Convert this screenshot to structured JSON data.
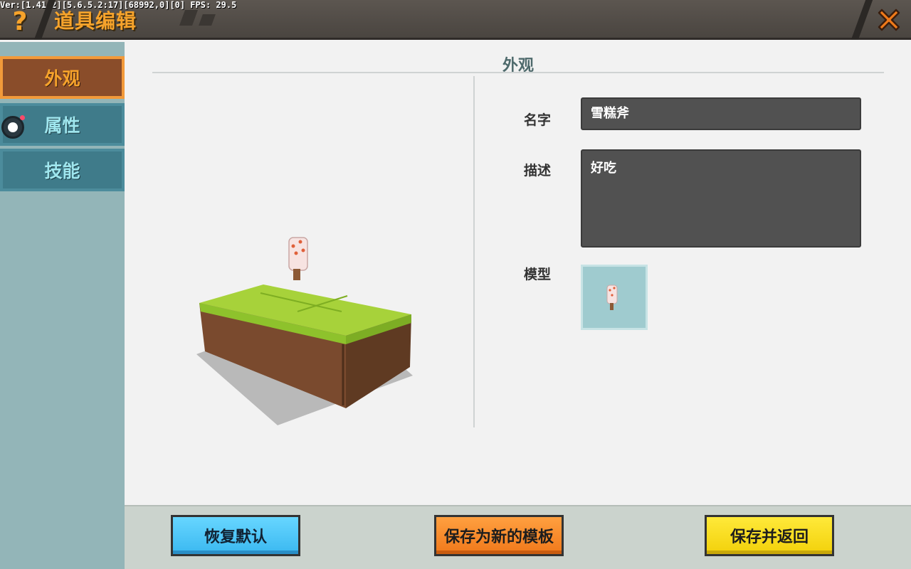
{
  "header": {
    "version": "Ver:[1.41.2][5.6.5.2:17][68992,0][0] FPS: 29.5",
    "help_glyph": "?",
    "title": "道具编辑",
    "help_icon": "question-mark-icon",
    "close_icon": "close-x-icon"
  },
  "sidebar": {
    "tabs": [
      {
        "label": "外观",
        "active": true
      },
      {
        "label": "属性",
        "active": false
      },
      {
        "label": "技能",
        "active": false
      }
    ],
    "toggle_icon": "toggle-switch-icon"
  },
  "main": {
    "section_title": "外观",
    "fields": {
      "name_label": "名字",
      "name_value": "雪糕斧",
      "desc_label": "描述",
      "desc_value": "好吃",
      "model_label": "模型"
    }
  },
  "footer": {
    "reset_label": "恢复默认",
    "save_template_label": "保存为新的模板",
    "save_return_label": "保存并返回"
  },
  "colors": {
    "accent_orange": "#f6a32b",
    "tab_active_bg": "#8a4d2a",
    "tab_inactive_bg": "#3f7b8a",
    "btn_blue": "#3ab8f0",
    "btn_orange": "#f0781a",
    "btn_yellow": "#f2d10a"
  }
}
